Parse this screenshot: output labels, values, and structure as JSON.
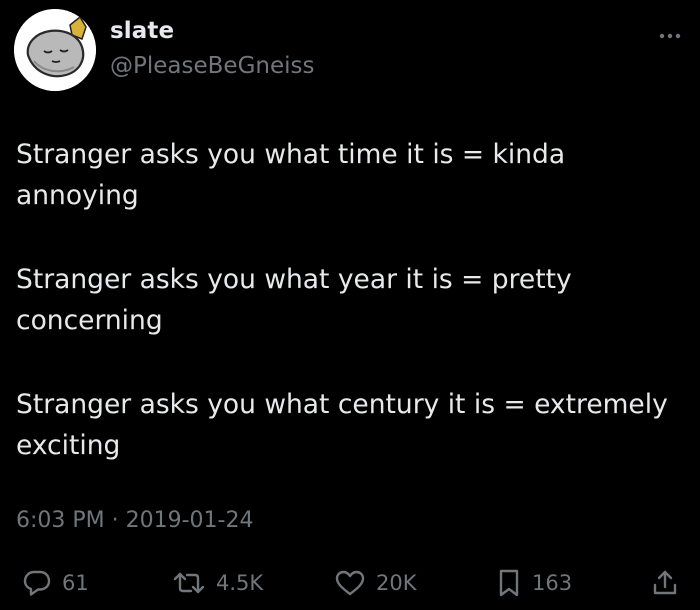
{
  "author": {
    "display_name": "slate",
    "handle": "@PleaseBeGneiss"
  },
  "tweet": {
    "paragraphs": [
      "Stranger asks you what time it is = kinda annoying",
      "Stranger asks you what year it is = pretty concerning",
      "Stranger asks you what century it is = extremely exciting"
    ],
    "timestamp": "6:03 PM · 2019-01-24"
  },
  "actions": {
    "replies": "61",
    "retweets": "4.5K",
    "likes": "20K",
    "bookmarks": "163"
  },
  "icons": {
    "more": "more-dots-icon",
    "reply": "reply-bubble-icon",
    "retweet": "retweet-icon",
    "like": "heart-icon",
    "bookmark": "bookmark-icon",
    "share": "share-upload-icon"
  },
  "colors": {
    "background": "#000000",
    "primary_text": "#e7e9ea",
    "secondary_text": "#71767b"
  }
}
